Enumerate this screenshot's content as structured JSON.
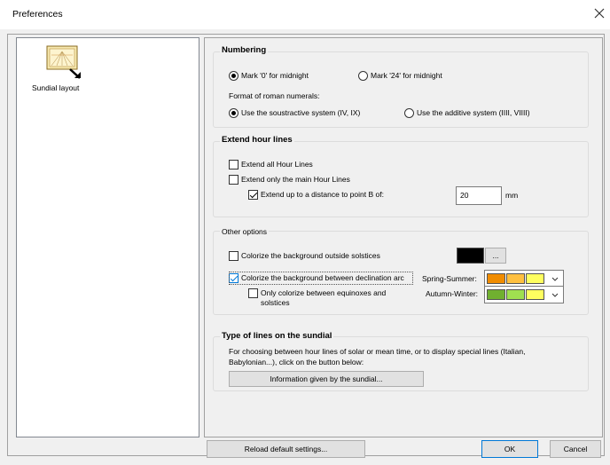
{
  "window": {
    "title": "Preferences",
    "close_icon": "close-icon"
  },
  "sidebar": {
    "items": [
      {
        "label": "Sundial layout",
        "icon": "sundial-layout-icon",
        "selected": true
      }
    ]
  },
  "numbering": {
    "title": "Numbering",
    "midnight_0": "Mark '0' for midnight",
    "midnight_24": "Mark '24' for midnight",
    "midnight_selected": "midnight_0",
    "format_label": "Format of roman numerals:",
    "subtractive": "Use the soustractive system (IV, IX)",
    "additive": "Use the additive system (IIII, VIIII)",
    "format_selected": "subtractive"
  },
  "extend": {
    "title": "Extend hour lines",
    "all": {
      "label": "Extend all Hour Lines",
      "checked": false
    },
    "main": {
      "label": "Extend only the main Hour Lines",
      "checked": false
    },
    "distance": {
      "label": "Extend up to a distance to point B of:",
      "checked": true,
      "value": "20",
      "unit": "mm"
    }
  },
  "other": {
    "title": "Other options",
    "outside": {
      "label": "Colorize the background outside solstices",
      "checked": false,
      "color": "#000000",
      "button": "..."
    },
    "between": {
      "label": "Colorize the background between declination arc",
      "checked": true
    },
    "equinox": {
      "label_line1": "Only colorize between equinoxes and",
      "label_line2": "solstices",
      "checked": false
    },
    "spring_label": "Spring-Summer:",
    "spring_colors": [
      "#f08c00",
      "#ffc040",
      "#ffff60"
    ],
    "autumn_label": "Autumn-Winter:",
    "autumn_colors": [
      "#70b030",
      "#a0e050",
      "#ffff60"
    ]
  },
  "lines": {
    "title": "Type of lines on the sundial",
    "description_line1": "For choosing between hour lines of solar or mean time, or to display special lines (Italian,",
    "description_line2": "Babylonian...), click on the button below:",
    "button": "Information given by the sundial..."
  },
  "footer": {
    "reload": "Reload default settings...",
    "ok": "OK",
    "cancel": "Cancel"
  }
}
